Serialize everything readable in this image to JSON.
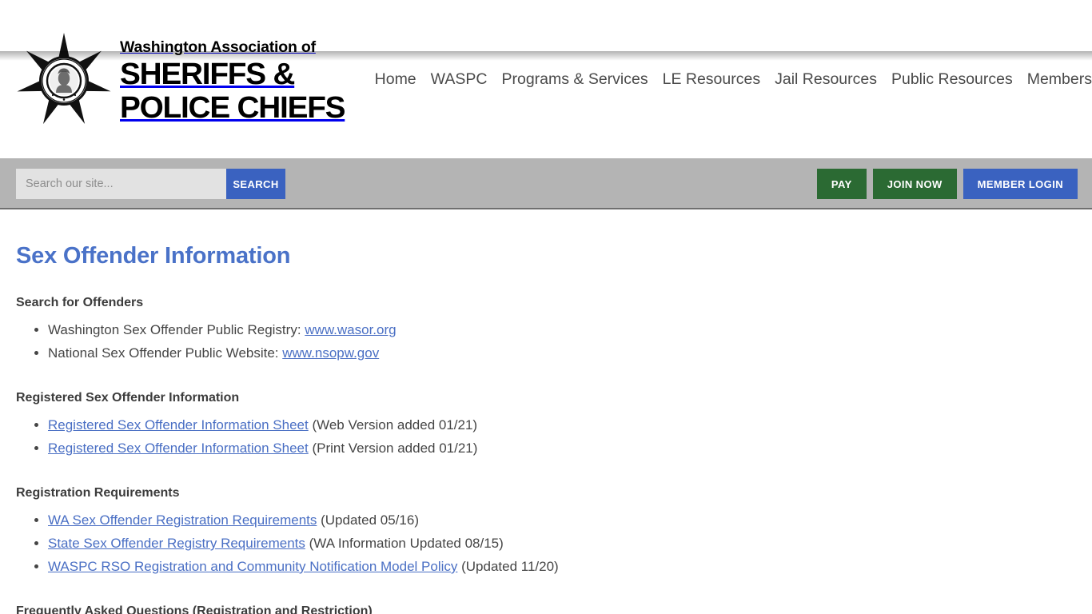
{
  "header": {
    "logo": {
      "badge_icon": "sheriff-star-badge-icon",
      "line1": "Washington Association of",
      "line2": "SHERIFFS &",
      "line3": "POLICE CHIEFS"
    },
    "nav_items": [
      {
        "label": "Home"
      },
      {
        "label": "WASPC"
      },
      {
        "label": "Programs & Services"
      },
      {
        "label": "LE Resources"
      },
      {
        "label": "Jail Resources"
      },
      {
        "label": "Public Resources"
      },
      {
        "label": "Members"
      }
    ]
  },
  "utility": {
    "search": {
      "placeholder": "Search our site...",
      "value": "",
      "submit_label": "SEARCH"
    },
    "actions": [
      {
        "label": "PAY",
        "style": "green"
      },
      {
        "label": "JOIN NOW",
        "style": "green"
      },
      {
        "label": "MEMBER LOGIN",
        "style": "blue"
      }
    ]
  },
  "main": {
    "title": "Sex Offender Information",
    "sections": [
      {
        "heading": "Search for Offenders",
        "items": [
          {
            "prefix": "Washington Sex Offender Public Registry: ",
            "link": "www.wasor.org",
            "suffix": ""
          },
          {
            "prefix": "National Sex Offender Public Website: ",
            "link": "www.nsopw.gov",
            "suffix": ""
          }
        ]
      },
      {
        "heading": "Registered Sex Offender Information",
        "items": [
          {
            "prefix": "",
            "link": "Registered Sex Offender Information Sheet",
            "suffix": " (Web Version added 01/21)"
          },
          {
            "prefix": "",
            "link": "Registered Sex Offender Information Sheet",
            "suffix": " (Print Version added 01/21)"
          }
        ]
      },
      {
        "heading": "Registration Requirements",
        "items": [
          {
            "prefix": "",
            "link": "WA Sex Offender Registration Requirements",
            "suffix": " (Updated 05/16)"
          },
          {
            "prefix": "",
            "link": "State Sex Offender Registry Requirements",
            "suffix": " (WA Information Updated 08/15)"
          },
          {
            "prefix": "",
            "link": "WASPC RSO Registration and Community Notification Model Policy",
            "suffix": " (Updated 11/20)"
          }
        ]
      },
      {
        "heading": "Frequently Asked Questions (Registration and Restriction)",
        "items": []
      }
    ]
  },
  "colors": {
    "title_blue": "#4a72c8",
    "link_blue": "#4a6fc4",
    "utility_bar_gray": "#b4b4b4",
    "button_green": "#2b6a33",
    "button_blue": "#3a62c0",
    "body_text": "#454545"
  }
}
